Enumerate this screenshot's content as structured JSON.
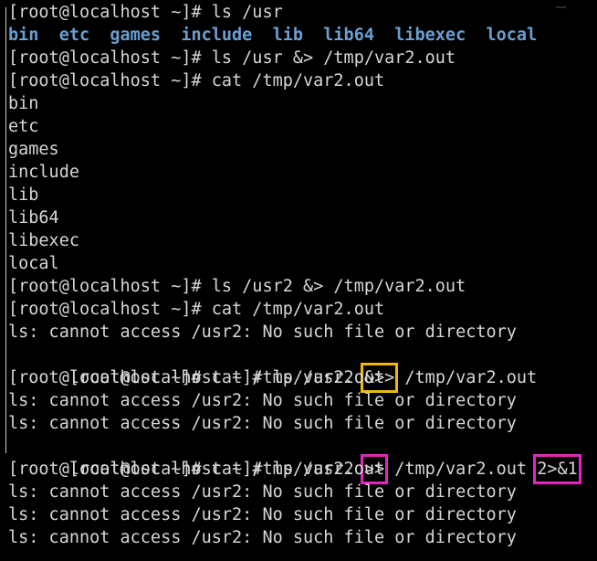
{
  "terminal": {
    "window_title": "",
    "prompt": "[root@localhost ~]# ",
    "colors": {
      "background": "#000000",
      "foreground": "#d6d6d6",
      "directory_blue": "#6a9fd4",
      "highlight_orange": "#f2b705",
      "highlight_magenta": "#e822c2",
      "border": "#cfcfcf"
    },
    "lines": [
      {
        "id": "l01",
        "type": "prompt",
        "text": "[root@localhost ~]# ls /usr"
      },
      {
        "id": "l02",
        "type": "dirs",
        "text": "bin  etc  games  include  lib  lib64  libexec  local"
      },
      {
        "id": "l03",
        "type": "prompt",
        "text": "[root@localhost ~]# ls /usr &> /tmp/var2.out"
      },
      {
        "id": "l04",
        "type": "prompt",
        "text": "[root@localhost ~]# cat /tmp/var2.out"
      },
      {
        "id": "l05",
        "type": "output",
        "text": "bin"
      },
      {
        "id": "l06",
        "type": "output",
        "text": "etc"
      },
      {
        "id": "l07",
        "type": "output",
        "text": "games"
      },
      {
        "id": "l08",
        "type": "output",
        "text": "include"
      },
      {
        "id": "l09",
        "type": "output",
        "text": "lib"
      },
      {
        "id": "l10",
        "type": "output",
        "text": "lib64"
      },
      {
        "id": "l11",
        "type": "output",
        "text": "libexec"
      },
      {
        "id": "l12",
        "type": "output",
        "text": "local"
      },
      {
        "id": "l13",
        "type": "prompt",
        "text": "[root@localhost ~]# ls /usr2 &> /tmp/var2.out"
      },
      {
        "id": "l14",
        "type": "prompt",
        "text": "[root@localhost ~]# cat /tmp/var2.out"
      },
      {
        "id": "l15",
        "type": "output",
        "text": "ls: cannot access /usr2: No such file or directory"
      },
      {
        "id": "l16",
        "type": "prompt-highlight-orange",
        "pre": "[root@localhost ~]# ls /usr2 ",
        "highlight": "&>>",
        "post": " /tmp/var2.out"
      },
      {
        "id": "l17",
        "type": "prompt",
        "text": "[root@localhost ~]# cat /tmp/var2.out"
      },
      {
        "id": "l18",
        "type": "output",
        "text": "ls: cannot access /usr2: No such file or directory"
      },
      {
        "id": "l19",
        "type": "output",
        "text": "ls: cannot access /usr2: No such file or directory"
      },
      {
        "id": "l20",
        "type": "prompt-highlight-magenta-two",
        "pre": "[root@localhost ~]# ls /usr2 ",
        "highlight1": ">>",
        "mid": " /tmp/var2.out ",
        "highlight2": "2>&1",
        "post": ""
      },
      {
        "id": "l21",
        "type": "prompt",
        "text": "[root@localhost ~]# cat /tmp/var2.out"
      },
      {
        "id": "l22",
        "type": "output",
        "text": "ls: cannot access /usr2: No such file or directory"
      },
      {
        "id": "l23",
        "type": "output",
        "text": "ls: cannot access /usr2: No such file or directory"
      },
      {
        "id": "l24",
        "type": "output",
        "text": "ls: cannot access /usr2: No such file or directory"
      }
    ]
  }
}
